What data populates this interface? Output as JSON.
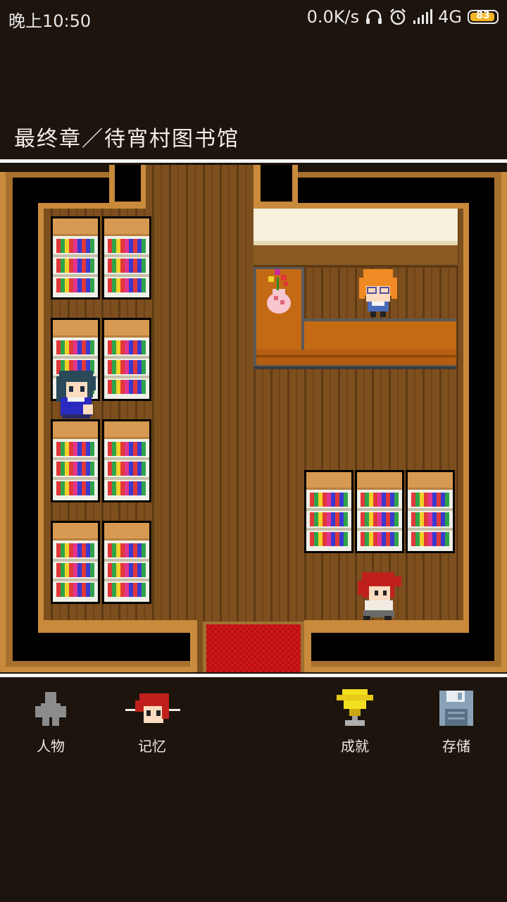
{
  "status": {
    "time": "晚上10:50",
    "network_speed": "0.0K/s",
    "network_type": "4G",
    "battery": "83",
    "icons": [
      "headphones-icon",
      "alarm-icon",
      "signal-icon"
    ]
  },
  "scene": {
    "title": "最终章／待宵村图书馆"
  },
  "menu": {
    "items": [
      {
        "label": "人物",
        "icon": "character-icon"
      },
      {
        "label": "记忆",
        "icon": "memory-portrait-icon"
      },
      {
        "label": "成就",
        "icon": "trophy-icon"
      },
      {
        "label": "存储",
        "icon": "save-disk-icon"
      }
    ]
  },
  "colors": {
    "wall_brown": "#c98a3c",
    "floor": "#7a4c1c",
    "counter": "#c36b12",
    "carpet": "#d01818"
  }
}
